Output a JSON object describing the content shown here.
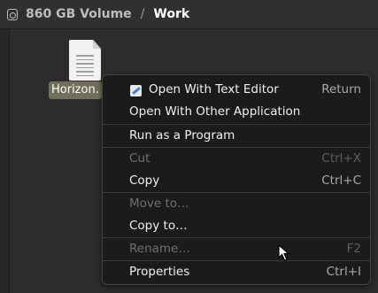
{
  "header": {
    "volume": "860 GB Volume",
    "separator": "/",
    "folder": "Work"
  },
  "file": {
    "name": "Horizon."
  },
  "menu": {
    "items": [
      {
        "label": "Open With Text Editor",
        "shortcut": "Return",
        "enabled": true
      },
      {
        "label": "Open With Other Application",
        "shortcut": "",
        "enabled": true
      },
      {
        "label": "Run as a Program",
        "shortcut": "",
        "enabled": true
      },
      {
        "label": "Cut",
        "shortcut": "Ctrl+X",
        "enabled": false
      },
      {
        "label": "Copy",
        "shortcut": "Ctrl+C",
        "enabled": true
      },
      {
        "label": "Move to…",
        "shortcut": "",
        "enabled": false
      },
      {
        "label": "Copy to…",
        "shortcut": "",
        "enabled": true
      },
      {
        "label": "Rename…",
        "shortcut": "F2",
        "enabled": false
      },
      {
        "label": "Properties",
        "shortcut": "Ctrl+I",
        "enabled": true
      }
    ]
  },
  "colors": {
    "background": "#2c2c2c",
    "menu_background": "#1b1b1b",
    "selected_label": "#6f6f5a",
    "text_editor_icon_accent": "#3d83d8"
  }
}
